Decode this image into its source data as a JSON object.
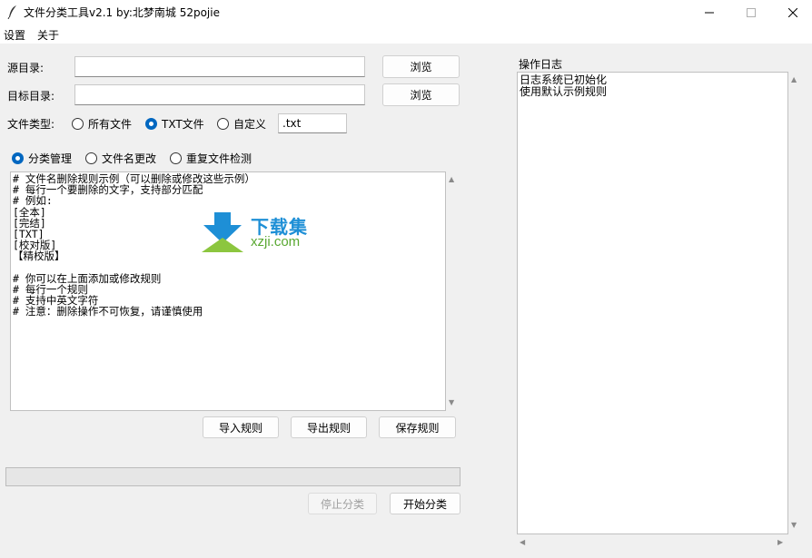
{
  "window": {
    "title": "文件分类工具v2.1  by:北梦南城 52pojie"
  },
  "menu": {
    "settings": "设置",
    "about": "关于"
  },
  "form": {
    "source_label": "源目录:",
    "source_value": "",
    "target_label": "目标目录:",
    "target_value": "",
    "browse_label": "浏览",
    "filetype_label": "文件类型:",
    "filetype_options": [
      "所有文件",
      "TXT文件",
      "自定义"
    ],
    "filetype_selected": "TXT文件",
    "custom_ext": ".txt"
  },
  "mode": {
    "options": [
      "分类管理",
      "文件名更改",
      "重复文件检测"
    ],
    "selected": "分类管理"
  },
  "rules": {
    "lines": [
      "# 文件名删除规则示例（可以删除或修改这些示例）",
      "# 每行一个要删除的文字，支持部分匹配",
      "# 例如:",
      "[全本]",
      "[完结]",
      "[TXT]",
      "[校对版]",
      "【精校版】",
      "",
      "# 你可以在上面添加或修改规则",
      "# 每行一个规则",
      "# 支持中英文字符",
      "# 注意：删除操作不可恢复，请谨慎使用"
    ],
    "import_label": "导入规则",
    "export_label": "导出规则",
    "save_label": "保存规则"
  },
  "progress": {
    "value": 0
  },
  "actions": {
    "stop_label": "停止分类",
    "start_label": "开始分类"
  },
  "log": {
    "title": "操作日志",
    "lines": [
      "日志系统已初始化",
      "使用默认示例规则"
    ]
  },
  "watermark": {
    "text_cn": "下载集",
    "text_url": "xzji.com"
  },
  "colors": {
    "accent": "#0067c0",
    "background": "#f0f0f0",
    "watermark_blue": "#1e8fd6",
    "watermark_green": "#5aa832"
  }
}
